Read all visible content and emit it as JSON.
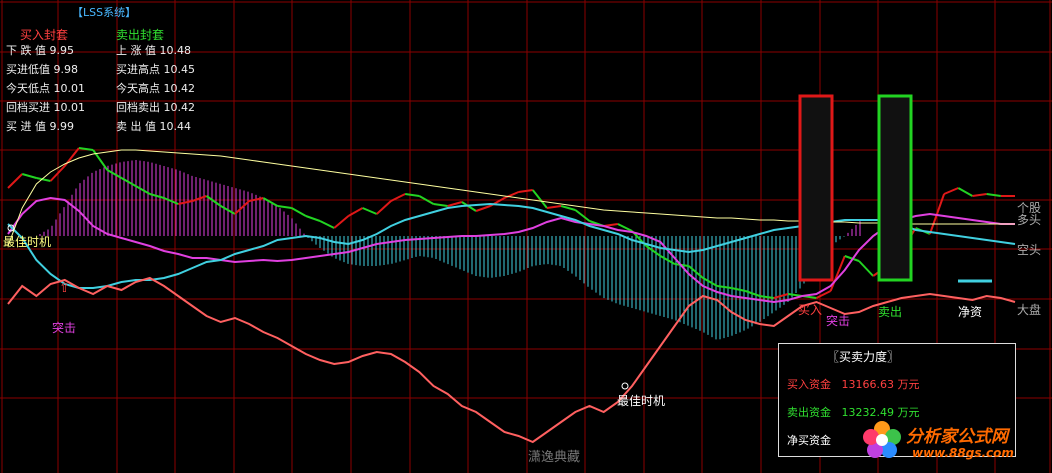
{
  "panel": {
    "title": "【LSS系统】",
    "buy_head": "买入封套",
    "sell_head": "卖出封套",
    "rows": [
      {
        "l": "下 跌 值",
        "lv": "9.95",
        "r": "上 涨 值",
        "rv": "10.48"
      },
      {
        "l": "买进低值",
        "lv": "9.98",
        "r": "买进高点",
        "rv": "10.45"
      },
      {
        "l": "今天低点",
        "lv": "10.01",
        "r": "今天高点",
        "rv": "10.42"
      },
      {
        "l": "回档买进",
        "lv": "10.01",
        "r": "回档卖出",
        "rv": "10.42"
      },
      {
        "l": "买 进 值",
        "lv": "9.99",
        "r": "卖 出 值",
        "rv": "10.44"
      }
    ]
  },
  "annotations": {
    "best_time_left": "最佳时机",
    "best_time_mid": "最佳时机",
    "breakout_left": "突击",
    "breakout_right": "突击",
    "buy_in": "买入",
    "sell_out": "卖出",
    "net_invest": "净资"
  },
  "right_labels": {
    "stock": "个股",
    "long": "多头",
    "short": "空头",
    "market": "大盘"
  },
  "info_box": {
    "title": "〖买卖力度〗",
    "buy_label": "买入资金",
    "buy_value": "13166.63",
    "sell_label": "卖出资金",
    "sell_value": "13232.49",
    "unit": "万元",
    "net_label": "净买资金"
  },
  "watermark": "潇逸典藏",
  "logo": {
    "name": "分析家公式网",
    "url": "www.88gs.com"
  },
  "colors": {
    "background": "#000000",
    "grid": "#8b0000",
    "stock_red": "#e01818",
    "stock_green": "#22d422",
    "cyan": "#40d0e0",
    "magenta": "#e040e0",
    "pink": "#ff6060",
    "yellow": "#ffffa0",
    "buy_text": "#ff4040",
    "sell_text": "#30e030"
  },
  "chart_data": {
    "type": "line",
    "title": "",
    "xlabel": "",
    "ylabel": "",
    "x_count": 72,
    "series": [
      {
        "name": "个股",
        "values": [
          48,
          62,
          58,
          55,
          70,
          88,
          86,
          66,
          58,
          50,
          42,
          38,
          32,
          35,
          40,
          30,
          22,
          35,
          38,
          30,
          28,
          20,
          15,
          8,
          20,
          28,
          22,
          35,
          42,
          40,
          32,
          30,
          34,
          25,
          30,
          38,
          44,
          46,
          28,
          30,
          26,
          15,
          10,
          12,
          5,
          -10,
          -20,
          -28,
          -30,
          -42,
          -50,
          -52,
          -55,
          -60,
          -62,
          -58,
          -60,
          -62,
          -55,
          -20,
          -25,
          -40,
          -30,
          -15,
          8,
          2,
          42,
          48,
          40,
          42,
          40,
          40
        ]
      },
      {
        "name": "多头",
        "values": [
          2,
          22,
          35,
          38,
          36,
          25,
          10,
          2,
          -2,
          -6,
          -10,
          -15,
          -18,
          -22,
          -22,
          -24,
          -26,
          -25,
          -24,
          -25,
          -24,
          -22,
          -20,
          -18,
          -16,
          -12,
          -8,
          -6,
          -4,
          -3,
          -2,
          -1,
          0,
          0,
          1,
          2,
          4,
          8,
          14,
          18,
          14,
          12,
          10,
          6,
          4,
          0,
          -6,
          -22,
          -38,
          -50,
          -56,
          -60,
          -62,
          -64,
          -66,
          -64,
          -60,
          -58,
          -50,
          -34,
          -14,
          0,
          10,
          16,
          20,
          22,
          20,
          18,
          16,
          14,
          12,
          12
        ]
      },
      {
        "name": "空头",
        "values": [
          12,
          -2,
          -24,
          -38,
          -48,
          -52,
          -52,
          -50,
          -46,
          -44,
          -44,
          -42,
          -38,
          -32,
          -26,
          -24,
          -18,
          -14,
          -10,
          -4,
          -2,
          0,
          -2,
          -6,
          -8,
          -4,
          2,
          10,
          16,
          20,
          24,
          28,
          30,
          31,
          32,
          31,
          30,
          28,
          24,
          20,
          16,
          10,
          6,
          2,
          -4,
          -8,
          -12,
          -14,
          -16,
          -14,
          -10,
          -6,
          -2,
          2,
          6,
          8,
          10,
          12,
          14,
          16,
          16,
          16,
          16,
          12,
          6,
          4,
          2,
          0,
          -2,
          -4,
          -6,
          -8
        ]
      },
      {
        "name": "大盘",
        "values": [
          -68,
          -50,
          -60,
          -48,
          -44,
          -52,
          -58,
          -50,
          -54,
          -46,
          -42,
          -50,
          -60,
          -70,
          -80,
          -86,
          -82,
          -88,
          -96,
          -102,
          -110,
          -118,
          -124,
          -128,
          -126,
          -120,
          -116,
          -118,
          -126,
          -136,
          -150,
          -158,
          -170,
          -176,
          -186,
          -196,
          -200,
          -206,
          -196,
          -186,
          -176,
          -170,
          -176,
          -166,
          -150,
          -130,
          -110,
          -90,
          -70,
          -60,
          -64,
          -76,
          -84,
          -88,
          -90,
          -80,
          -70,
          -66,
          -72,
          -78,
          -76,
          -70,
          -66,
          -62,
          -60,
          -58,
          -60,
          -62,
          -64,
          -60,
          -62,
          -66
        ]
      },
      {
        "name": "",
        "values": [
          -10,
          28,
          52,
          64,
          72,
          78,
          82,
          84,
          86,
          86,
          85,
          84,
          83,
          82,
          81,
          80,
          78,
          76,
          74,
          72,
          70,
          68,
          66,
          64,
          62,
          60,
          58,
          56,
          54,
          52,
          50,
          48,
          46,
          44,
          42,
          40,
          38,
          36,
          34,
          32,
          30,
          28,
          26,
          25,
          24,
          23,
          22,
          21,
          20,
          19,
          18,
          18,
          17,
          16,
          16,
          15,
          15,
          14,
          14,
          14,
          13,
          13,
          13,
          12,
          12,
          12,
          12,
          12,
          12,
          12,
          12,
          12
        ]
      }
    ],
    "histogram": [
      0,
      0,
      0,
      8,
      30,
      52,
      64,
      70,
      74,
      76,
      74,
      70,
      66,
      60,
      56,
      52,
      48,
      44,
      38,
      30,
      18,
      0,
      -12,
      -22,
      -28,
      -30,
      -30,
      -28,
      -24,
      -20,
      -22,
      -28,
      -34,
      -40,
      -42,
      -40,
      -36,
      -30,
      -28,
      -30,
      -40,
      -52,
      -62,
      -68,
      -72,
      -76,
      -80,
      -84,
      -90,
      -96,
      -104,
      -100,
      -94,
      -86,
      -76,
      -66,
      -50,
      -30,
      -10,
      0,
      14,
      26,
      32,
      34,
      34,
      33,
      32,
      30,
      28,
      26,
      24,
      22
    ]
  }
}
